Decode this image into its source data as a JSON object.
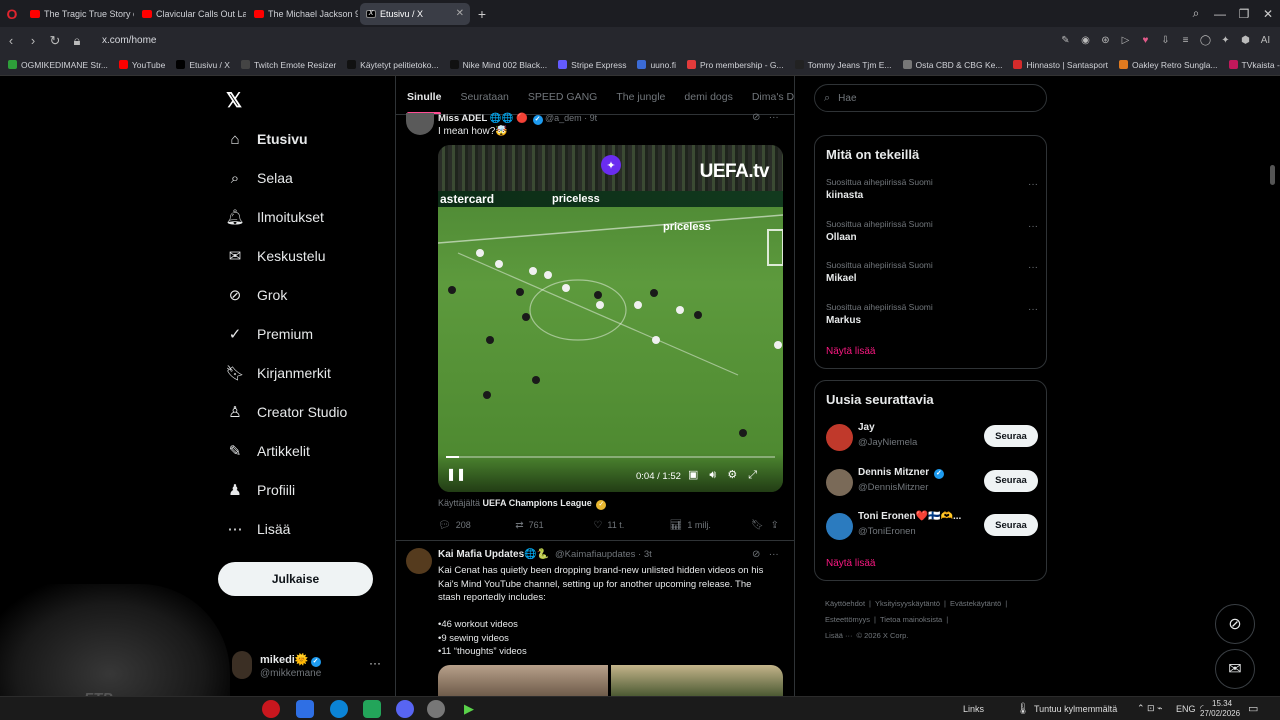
{
  "browser": {
    "tabs": [
      {
        "title": "The Tragic True Story of Ju",
        "active": false
      },
      {
        "title": "Clavicular Calls Out Larry",
        "active": false
      },
      {
        "title": "The Michael Jackson 911 ",
        "active": false
      },
      {
        "title": "Etusivu / X",
        "active": true
      }
    ],
    "url": "x.com/home",
    "bookmarks": [
      {
        "label": "OGMIKEDIMANE Str...",
        "color": "#2e9e3a"
      },
      {
        "label": "YouTube",
        "color": "#ff0000"
      },
      {
        "label": "Etusivu / X",
        "color": "#000000"
      },
      {
        "label": "Twitch Emote Resizer",
        "color": "#444444"
      },
      {
        "label": "Käytetyt pelitietoko...",
        "color": "#111111"
      },
      {
        "label": "Nike Mind 002 Black...",
        "color": "#111111"
      },
      {
        "label": "Stripe Express",
        "color": "#635bff"
      },
      {
        "label": "uuno.fi",
        "color": "#3b6bd6"
      },
      {
        "label": "Pro membership - G...",
        "color": "#e23b3b"
      },
      {
        "label": "Tommy Jeans Tjm E...",
        "color": "#222222"
      },
      {
        "label": "Osta CBD & CBG Ke...",
        "color": "#777777"
      },
      {
        "label": "Hinnasto | Santasport",
        "color": "#d42b2b"
      },
      {
        "label": "Oakley Retro Sungla...",
        "color": "#e07a1f"
      },
      {
        "label": "TVkaista - Sub Suora",
        "color": "#c2185b"
      }
    ]
  },
  "nav": {
    "items": [
      {
        "label": "Etusivu",
        "icon": "home-icon"
      },
      {
        "label": "Selaa",
        "icon": "search-icon"
      },
      {
        "label": "Ilmoitukset",
        "icon": "bell-icon"
      },
      {
        "label": "Keskustelu",
        "icon": "mail-icon"
      },
      {
        "label": "Grok",
        "icon": "grok-icon"
      },
      {
        "label": "Premium",
        "icon": "verified-icon"
      },
      {
        "label": "Kirjanmerkit",
        "icon": "bookmark-icon"
      },
      {
        "label": "Creator Studio",
        "icon": "creator-icon"
      },
      {
        "label": "Artikkelit",
        "icon": "article-icon"
      },
      {
        "label": "Profiili",
        "icon": "profile-icon"
      },
      {
        "label": "Lisää",
        "icon": "more-icon"
      }
    ],
    "post_label": "Julkaise",
    "me": {
      "name": "mikedi",
      "handle": "@mikkemane"
    }
  },
  "feed": {
    "tabs": [
      "Sinulle",
      "Seurataan",
      "SPEED GANG",
      "The jungle",
      "demi dogs",
      "Dima's Dist"
    ],
    "tweet1": {
      "name": "Miss ADEL",
      "handle": "@a_dem · 9t",
      "text": "I mean how?🤯",
      "video": {
        "brand": "UEFA.tv",
        "ad1": "astercard",
        "ad2": "priceless",
        "ad3": "priceless",
        "time": "0:04 / 1:52",
        "progress": 0.04
      },
      "from_prefix": "Käyttäjältä",
      "from_name": "UEFA Champions League",
      "stats": {
        "replies": "208",
        "reposts": "761",
        "likes": "11 t.",
        "views": "1 milj."
      }
    },
    "tweet2": {
      "name": "Kai Mafia Updates",
      "handle": "@Kaimafiaupdates · 3t",
      "lines": [
        "Kai Cenat has quietly been dropping brand-new unlisted hidden videos on his",
        "Kai's Mind YouTube channel, setting up for another upcoming release. The",
        "stash reportedly includes:",
        "",
        "•46 workout videos",
        "•9 sewing videos",
        "•11 “thoughts” videos"
      ]
    }
  },
  "sidebar": {
    "search_placeholder": "Hae",
    "trends_title": "Mitä on tekeillä",
    "trends": [
      {
        "context": "Suosittua aihepiirissä Suomi",
        "name": "kiinasta"
      },
      {
        "context": "Suosittua aihepiirissä Suomi",
        "name": "Ollaan"
      },
      {
        "context": "Suosittua aihepiirissä Suomi",
        "name": "Mikael"
      },
      {
        "context": "Suosittua aihepiirissä Suomi",
        "name": "Markus"
      }
    ],
    "show_more": "Näytä lisää",
    "follow_title": "Uusia seurattavia",
    "follow": [
      {
        "name": "Jay",
        "handle": "@JayNiemela",
        "button": "Seuraa",
        "color": "#c0392b"
      },
      {
        "name": "Dennis Mitzner",
        "handle": "@DennisMitzner",
        "button": "Seuraa",
        "color": "#7a6a58"
      },
      {
        "name": "Toni Eronen❤️🇫🇮🫶...",
        "handle": "@ToniEronen",
        "button": "Seuraa",
        "color": "#2b7bbf"
      }
    ],
    "footer": [
      "Käyttöehdot",
      "|",
      "Yksityisyyskäytäntö",
      "|",
      "Evästekäytäntö",
      "|",
      "Esteettömyys",
      "|",
      "Tietoa mainoksista",
      "|",
      "Lisää ···",
      "© 2026 X Corp."
    ]
  },
  "taskbar": {
    "links": "Links",
    "weather": "Tuntuu kylmemmältä",
    "lang": "ENG",
    "time": "15.34",
    "date": "27/02/2026"
  }
}
